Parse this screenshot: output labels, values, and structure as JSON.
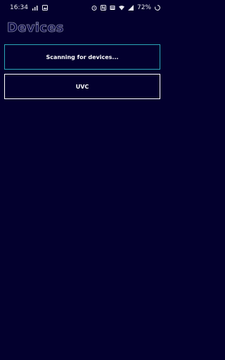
{
  "status_bar": {
    "time": "16:34",
    "battery_percent": "72%",
    "icons_left": [
      "signal-bars-icon",
      "image-icon"
    ],
    "icons_right": [
      "alarm-icon",
      "nfc-icon",
      "data-icon",
      "wifi-icon",
      "signal-icon",
      "battery-ring-icon"
    ]
  },
  "header": {
    "title": "Devices"
  },
  "devices": {
    "scanning_label": "Scanning for devices...",
    "items": [
      {
        "label": "UVC"
      }
    ]
  },
  "colors": {
    "background": "#03002e",
    "scanning_border": "#2aa6b8",
    "item_border": "#ffffff",
    "text": "#ffffff"
  }
}
